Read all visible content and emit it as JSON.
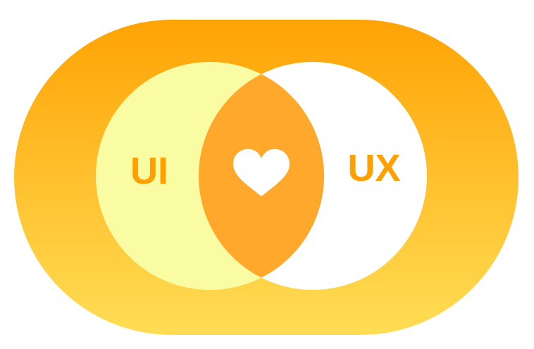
{
  "diagram": {
    "left_circle_label": "UI",
    "right_circle_label": "UX",
    "intersection_icon": "heart-icon"
  },
  "colors": {
    "outer_gradient_top": "#FFA305",
    "outer_gradient_bottom": "#FFDD55",
    "left_circle_fill": "#FAFCA4",
    "right_circle_fill": "#FFFFFF",
    "intersection_fill": "#FFA82B",
    "label_color": "#FFA000",
    "heart_color": "#FFFFFF"
  }
}
